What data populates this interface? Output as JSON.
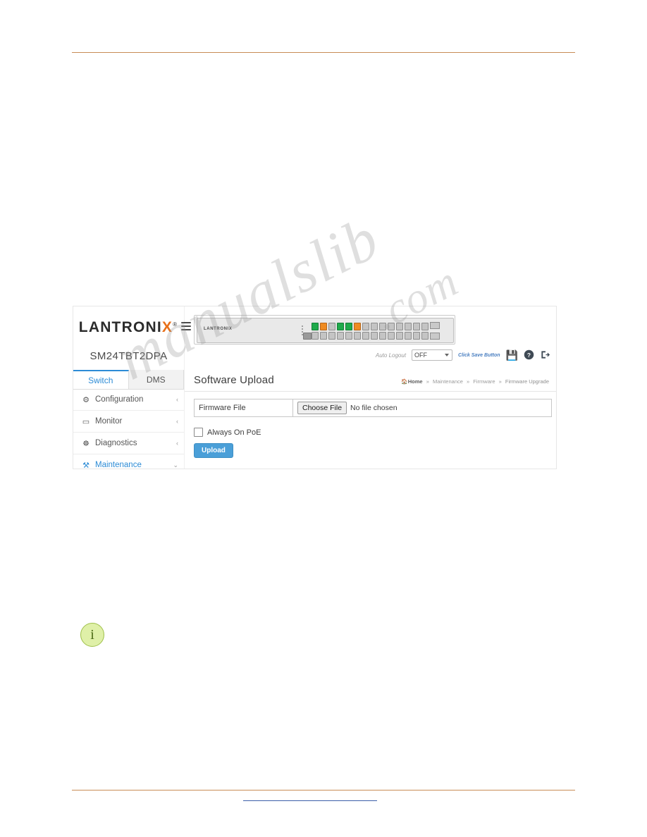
{
  "document": {
    "watermark_line1": "manualslib",
    "watermark_line2": ".com"
  },
  "info_icon": {
    "glyph": "i",
    "name": "info-icon"
  },
  "ui": {
    "brand": {
      "name_part1": "LANTRONI",
      "name_x": "X",
      "registered": "®"
    },
    "model": "SM24TBT2DPA",
    "tabs": [
      {
        "label": "Switch",
        "active": true
      },
      {
        "label": "DMS",
        "active": false
      }
    ],
    "nav": [
      {
        "label": "Configuration",
        "icon": "⚙",
        "arrow": "‹",
        "active": false
      },
      {
        "label": "Monitor",
        "icon": "▭",
        "arrow": "‹",
        "active": false
      },
      {
        "label": "Diagnostics",
        "icon": "☸",
        "arrow": "‹",
        "active": false
      },
      {
        "label": "Maintenance",
        "icon": "⚒",
        "arrow": "⌄",
        "active": true
      }
    ],
    "device": {
      "label": "LANTRONIX"
    },
    "toolbar": {
      "auto_logout_label": "Auto Logout",
      "auto_logout_value": "OFF",
      "click_save_text": "Click Save Button",
      "save_icon": "💾",
      "help_icon": "?",
      "logout_icon": "↪"
    },
    "page_title": "Software Upload",
    "breadcrumb": {
      "home": "Home",
      "items": [
        "Maintenance",
        "Firmware",
        "Firmware Upgrade"
      ],
      "separator": "»"
    },
    "form": {
      "field_label": "Firmware File",
      "choose_file_button": "Choose File",
      "file_status": "No file chosen",
      "checkbox_label": "Always On PoE",
      "checkbox_checked": false,
      "upload_button": "Upload"
    },
    "colors": {
      "accent_blue": "#2d8cd6",
      "brand_orange": "#e8701a",
      "button_blue": "#4a9fd8",
      "port_green": "#1faa4b",
      "port_orange": "#ef8b22"
    }
  }
}
